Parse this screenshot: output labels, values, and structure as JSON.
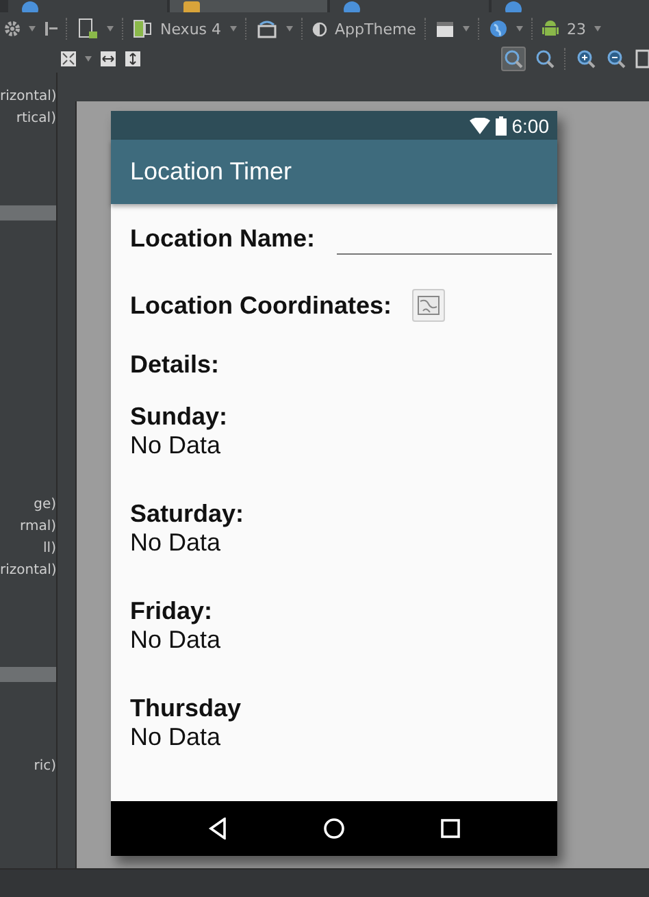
{
  "editor_tabs": [
    {
      "selected": false
    },
    {
      "selected": true
    },
    {
      "selected": false
    },
    {
      "selected": false
    }
  ],
  "toolbar": {
    "device": "Nexus 4",
    "theme": "AppTheme",
    "api_level": "23"
  },
  "palette_items": [
    {
      "kind": "text",
      "text": "rizontal)"
    },
    {
      "kind": "text",
      "text": "rtical)"
    },
    {
      "kind": "header"
    },
    {
      "kind": "text",
      "text": "ge)"
    },
    {
      "kind": "text",
      "text": "rmal)"
    },
    {
      "kind": "text",
      "text": "ll)"
    },
    {
      "kind": "text",
      "text": "rizontal)"
    },
    {
      "kind": "header"
    },
    {
      "kind": "text",
      "text": "ric)"
    }
  ],
  "phone": {
    "status_time": "6:00",
    "app_title": "Location Timer",
    "fields": [
      {
        "kind": "text_input",
        "label": "Location Name:"
      },
      {
        "kind": "map_button",
        "label": "Location Coordinates:"
      }
    ],
    "details_label": "Details:",
    "days": [
      {
        "day": "Sunday:",
        "value": "No Data"
      },
      {
        "day": "Saturday:",
        "value": "No Data"
      },
      {
        "day": "Friday:",
        "value": "No Data"
      },
      {
        "day": "Thursday",
        "value": "No Data"
      }
    ]
  }
}
